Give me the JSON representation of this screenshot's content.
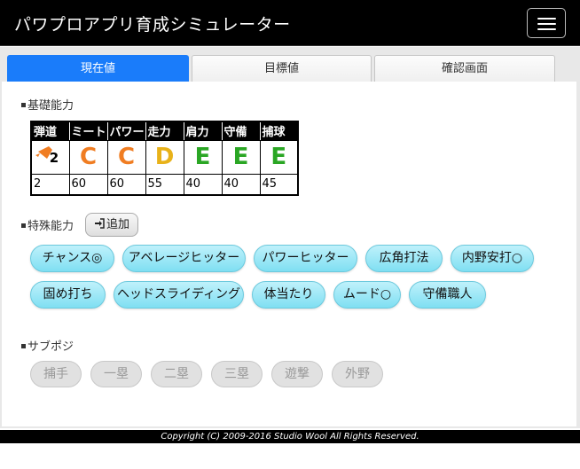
{
  "header": {
    "title": "パワプロアプリ育成シミュレーター",
    "menu_icon": "hamburger-icon"
  },
  "tabs": [
    {
      "label": "現在値",
      "active": true
    },
    {
      "label": "目標値",
      "active": false
    },
    {
      "label": "確認画面",
      "active": false
    }
  ],
  "basic": {
    "title": "基礎能力",
    "headers": [
      "弾道",
      "ミート",
      "パワー",
      "走力",
      "肩力",
      "守備",
      "捕球"
    ],
    "ranks": [
      "2",
      "C",
      "C",
      "D",
      "E",
      "E",
      "E"
    ],
    "values": [
      "2",
      "60",
      "60",
      "55",
      "40",
      "40",
      "45"
    ]
  },
  "special": {
    "title": "特殊能力",
    "add_label": "追加",
    "add_icon": "sign-in-icon",
    "abilities": [
      "チャンス◎",
      "アベレージヒッター",
      "パワーヒッター",
      "広角打法",
      "内野安打○",
      "固め打ち",
      "ヘッドスライディング",
      "体当たり",
      "ムード○",
      "守備職人"
    ]
  },
  "subpos": {
    "title": "サブポジ",
    "positions": [
      "捕手",
      "一塁",
      "二塁",
      "三塁",
      "遊撃",
      "外野"
    ]
  },
  "footer": {
    "copyright": "Copyright (C) 2009-2016 Studio Wool All Rights Reserved."
  },
  "colors": {
    "tab_active": "#1a7cfa",
    "rank_C": "#f07d22",
    "rank_D": "#e8b21a",
    "rank_E": "#2aa624",
    "pill": "#9fe8f7"
  }
}
